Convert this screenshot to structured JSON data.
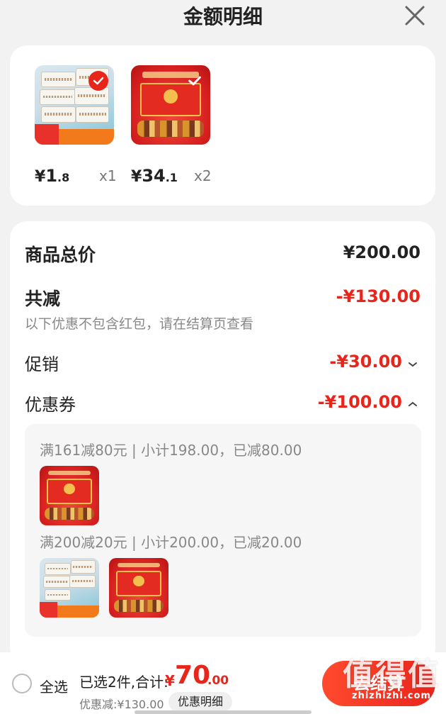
{
  "header": {
    "title": "金额明细",
    "close_icon": "close-icon"
  },
  "products": [
    {
      "image": "cotton-swab-pack",
      "image_text_badge": "京东自营 包邮",
      "image_text_banner": "一次性双头棉签",
      "price_cur": "¥",
      "price_int": "1",
      "price_dec": ".8",
      "qty": "x1"
    },
    {
      "image": "red-gift-box",
      "image_text": "大吉大利 福满佳节",
      "price_cur": "¥",
      "price_int": "34",
      "price_dec": ".1",
      "qty": "x2"
    }
  ],
  "summary": {
    "subtotal_label": "商品总价",
    "subtotal_value": "¥200.00",
    "reduce_label": "共减",
    "reduce_value": "-¥130.00",
    "reduce_note": "以下优惠不包含红包，请在结算页查看",
    "promo_label": "促销",
    "promo_value": "-¥30.00",
    "coupon_label": "优惠券",
    "coupon_value": "-¥100.00",
    "coupon_rules": [
      "满161减80元 | 小计198.00，已减80.00",
      "满200减20元 | 小计200.00，已减20.00"
    ]
  },
  "footer": {
    "select_all": "全选",
    "total_text": "已选2件,合计:",
    "total_cur": "¥",
    "total_int": "70",
    "total_dec": ".00",
    "discount_text": "优惠减:¥130.00",
    "detail_button": "优惠明细",
    "checkout_button": "去结算"
  },
  "watermark": {
    "logo": "值得值",
    "url": "zhizhizhi.com"
  },
  "colors": {
    "accent_red": "#e8251b",
    "background": "#f2f2f2",
    "card": "#ffffff"
  }
}
